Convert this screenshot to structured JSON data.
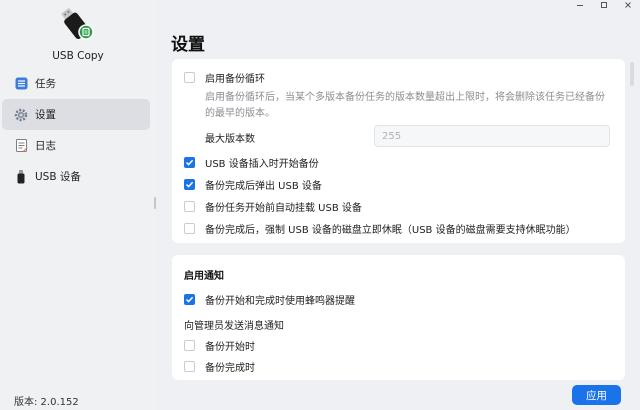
{
  "app": {
    "name": "USB Copy",
    "version": "版本: 2.0.152"
  },
  "colors": {
    "accent": "#1a73e8",
    "sidebar_bg": "#f0f1f3",
    "active_nav": "#dcdee3"
  },
  "sidebar": {
    "items": [
      {
        "label": "任务",
        "icon": "task-list-icon",
        "active": false
      },
      {
        "label": "设置",
        "icon": "gear-icon",
        "active": true
      },
      {
        "label": "日志",
        "icon": "log-icon",
        "active": false
      },
      {
        "label": "USB 设备",
        "icon": "usb-drive-icon",
        "active": false
      }
    ]
  },
  "main": {
    "title": "设置",
    "backup_rotation": {
      "enable_label": "启用备份循环",
      "enabled": false,
      "description": "启用备份循环后，当某个多版本备份任务的版本数量超出上限时，将会删除该任务已经备份的最早的版本。",
      "max_versions_label": "最大版本数",
      "max_versions_placeholder": "255"
    },
    "options": [
      {
        "label": "USB 设备插入时开始备份",
        "checked": true
      },
      {
        "label": "备份完成后弹出 USB 设备",
        "checked": true
      },
      {
        "label": "备份任务开始前自动挂载 USB 设备",
        "checked": false
      },
      {
        "label": "备份完成后，强制 USB 设备的磁盘立即休眠（USB 设备的磁盘需要支持休眠功能）",
        "checked": false
      }
    ],
    "notifications": {
      "title": "启用通知",
      "beeper_label": "备份开始和完成时使用蜂鸣器提醒",
      "beeper_checked": true,
      "admin_label": "向管理员发送消息通知",
      "admin_options": [
        {
          "label": "备份开始时",
          "checked": false
        },
        {
          "label": "备份完成时",
          "checked": false
        }
      ]
    },
    "apply_label": "应用"
  }
}
